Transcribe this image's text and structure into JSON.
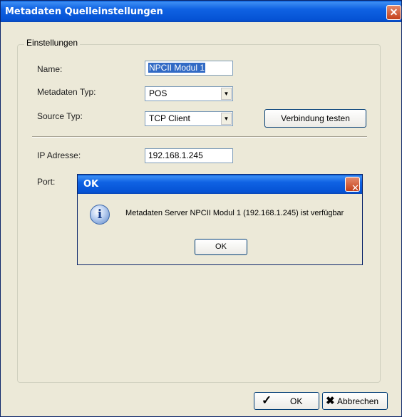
{
  "window": {
    "title": "Metadaten Quelleinstellungen",
    "close_glyph": "✕"
  },
  "group": {
    "label": "Einstellungen"
  },
  "form": {
    "name_label": "Name:",
    "name_value": "NPCII Modul 1",
    "metadata_type_label": "Metadaten Typ:",
    "metadata_type_value": "POS",
    "source_type_label": "Source Typ:",
    "source_type_value": "TCP Client",
    "test_connection_label": "Verbindung testen",
    "ip_label": "IP Adresse:",
    "ip_value": "192.168.1.245",
    "port_label": "Port:"
  },
  "dialog": {
    "title": "OK",
    "message": "Metadaten Server NPCII Modul 1 (192.168.1.245) ist verfügbar",
    "ok_label": "OK",
    "icon": "info-icon"
  },
  "footer": {
    "ok_label": "OK",
    "cancel_label": "Abbrechen"
  },
  "colors": {
    "titlebar": "#0552D4",
    "window_bg": "#ECE9D8",
    "selection": "#316AC5"
  }
}
